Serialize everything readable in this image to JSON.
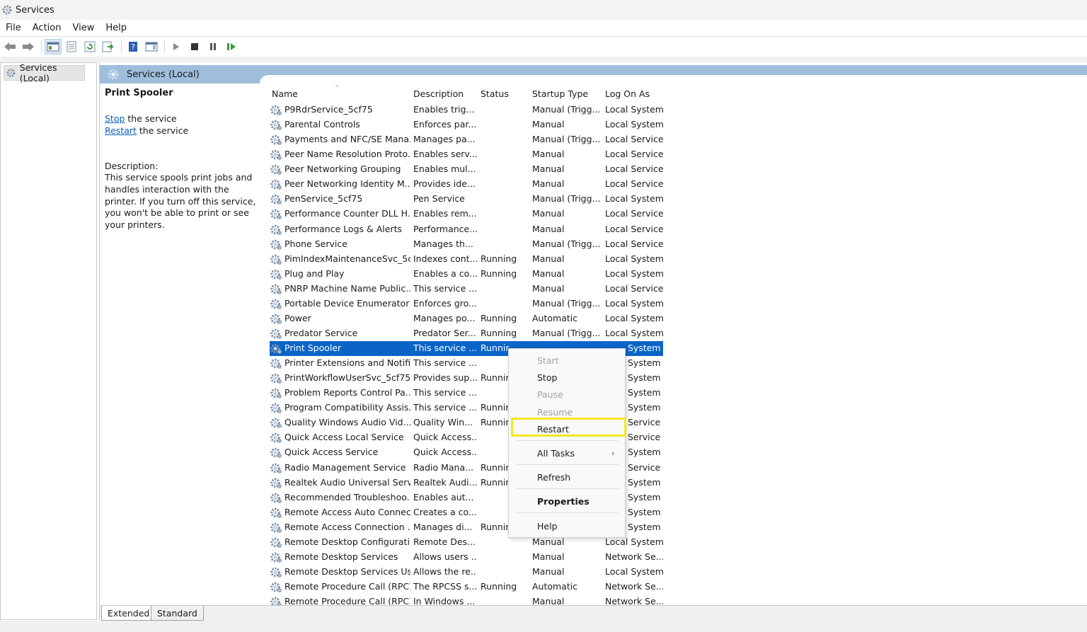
{
  "window": {
    "title": "Services"
  },
  "menu": [
    "File",
    "Action",
    "View",
    "Help"
  ],
  "tree": {
    "root_label": "Services (Local)"
  },
  "pane": {
    "header": "Services (Local)"
  },
  "details": {
    "service_name": "Print Spooler",
    "stop_link": "Stop",
    "stop_suffix": " the service",
    "restart_link": "Restart",
    "restart_suffix": " the service",
    "desc_label": "Description:",
    "desc_text": "This service spools print jobs and handles interaction with the printer. If you turn off this service, you won't be able to print or see your printers."
  },
  "columns": [
    "Name",
    "Description",
    "Status",
    "Startup Type",
    "Log On As"
  ],
  "rows": [
    {
      "name": "P9RdrService_5cf75",
      "desc": "Enables trig...",
      "status": "",
      "startup": "Manual (Trigg...",
      "logon": "Local System"
    },
    {
      "name": "Parental Controls",
      "desc": "Enforces par...",
      "status": "",
      "startup": "Manual",
      "logon": "Local System"
    },
    {
      "name": "Payments and NFC/SE Mana...",
      "desc": "Manages pa...",
      "status": "",
      "startup": "Manual (Trigg...",
      "logon": "Local Service"
    },
    {
      "name": "Peer Name Resolution Proto...",
      "desc": "Enables serv...",
      "status": "",
      "startup": "Manual",
      "logon": "Local Service"
    },
    {
      "name": "Peer Networking Grouping",
      "desc": "Enables mul...",
      "status": "",
      "startup": "Manual",
      "logon": "Local Service"
    },
    {
      "name": "Peer Networking Identity M...",
      "desc": "Provides ide...",
      "status": "",
      "startup": "Manual",
      "logon": "Local Service"
    },
    {
      "name": "PenService_5cf75",
      "desc": "Pen Service",
      "status": "",
      "startup": "Manual (Trigg...",
      "logon": "Local System"
    },
    {
      "name": "Performance Counter DLL H...",
      "desc": "Enables rem...",
      "status": "",
      "startup": "Manual",
      "logon": "Local Service"
    },
    {
      "name": "Performance Logs & Alerts",
      "desc": "Performance...",
      "status": "",
      "startup": "Manual",
      "logon": "Local Service"
    },
    {
      "name": "Phone Service",
      "desc": "Manages th...",
      "status": "",
      "startup": "Manual (Trigg...",
      "logon": "Local Service"
    },
    {
      "name": "PimIndexMaintenanceSvc_5c...",
      "desc": "Indexes cont...",
      "status": "Running",
      "startup": "Manual",
      "logon": "Local System"
    },
    {
      "name": "Plug and Play",
      "desc": "Enables a co...",
      "status": "Running",
      "startup": "Manual",
      "logon": "Local System"
    },
    {
      "name": "PNRP Machine Name Public...",
      "desc": "This service ...",
      "status": "",
      "startup": "Manual",
      "logon": "Local Service"
    },
    {
      "name": "Portable Device Enumerator ...",
      "desc": "Enforces gro...",
      "status": "",
      "startup": "Manual (Trigg...",
      "logon": "Local System"
    },
    {
      "name": "Power",
      "desc": "Manages po...",
      "status": "Running",
      "startup": "Automatic",
      "logon": "Local System"
    },
    {
      "name": "Predator Service",
      "desc": "Predator Ser...",
      "status": "Running",
      "startup": "Manual (Trigg...",
      "logon": "Local System"
    },
    {
      "name": "Print Spooler",
      "desc": "This service ...",
      "status": "Runnir",
      "startup": "",
      "logon": "System",
      "selected": true
    },
    {
      "name": "Printer Extensions and Notifi...",
      "desc": "This service ...",
      "status": "",
      "startup": "",
      "logon": "System"
    },
    {
      "name": "PrintWorkflowUserSvc_5cf75",
      "desc": "Provides sup...",
      "status": "Runnir",
      "startup": "",
      "logon": "System"
    },
    {
      "name": "Problem Reports Control Pa...",
      "desc": "This service ...",
      "status": "",
      "startup": "",
      "logon": "System"
    },
    {
      "name": "Program Compatibility Assis...",
      "desc": "This service ...",
      "status": "Runnir",
      "startup": "",
      "logon": "System"
    },
    {
      "name": "Quality Windows Audio Vid...",
      "desc": "Quality Win...",
      "status": "Runnir",
      "startup": "",
      "logon": "Service"
    },
    {
      "name": "Quick Access Local Service",
      "desc": "Quick Access...",
      "status": "",
      "startup": "",
      "logon": "Service"
    },
    {
      "name": "Quick Access Service",
      "desc": "Quick Access...",
      "status": "",
      "startup": "",
      "logon": "System"
    },
    {
      "name": "Radio Management Service",
      "desc": "Radio Mana...",
      "status": "Runnir",
      "startup": "",
      "logon": "Service"
    },
    {
      "name": "Realtek Audio Universal Serv...",
      "desc": "Realtek Audi...",
      "status": "Runnir",
      "startup": "",
      "logon": "System"
    },
    {
      "name": "Recommended Troubleshoo...",
      "desc": "Enables aut...",
      "status": "",
      "startup": "",
      "logon": "System"
    },
    {
      "name": "Remote Access Auto Connec...",
      "desc": "Creates a co...",
      "status": "",
      "startup": "",
      "logon": "System"
    },
    {
      "name": "Remote Access Connection ...",
      "desc": "Manages di...",
      "status": "Runnir",
      "startup": "",
      "logon": "System"
    },
    {
      "name": "Remote Desktop Configurati...",
      "desc": "Remote Des...",
      "status": "",
      "startup": "Manual",
      "logon": "Local System"
    },
    {
      "name": "Remote Desktop Services",
      "desc": "Allows users ...",
      "status": "",
      "startup": "Manual",
      "logon": "Network Se..."
    },
    {
      "name": "Remote Desktop Services Us...",
      "desc": "Allows the re...",
      "status": "",
      "startup": "Manual",
      "logon": "Local System"
    },
    {
      "name": "Remote Procedure Call (RPC)",
      "desc": "The RPCSS s...",
      "status": "Running",
      "startup": "Automatic",
      "logon": "Network Se..."
    },
    {
      "name": "Remote Procedure Call (RPC)...",
      "desc": "In Windows ...",
      "status": "",
      "startup": "Manual",
      "logon": "Network Se..."
    }
  ],
  "context_menu": {
    "start": "Start",
    "stop": "Stop",
    "pause": "Pause",
    "resume": "Resume",
    "restart": "Restart",
    "all_tasks": "All Tasks",
    "refresh": "Refresh",
    "properties": "Properties",
    "help": "Help"
  },
  "tabs": [
    "Extended",
    "Standard"
  ],
  "colors": {
    "selection": "#0a64c8",
    "header": "#9ebedc",
    "highlight": "#f5e71e",
    "link": "#0a5fb4"
  }
}
